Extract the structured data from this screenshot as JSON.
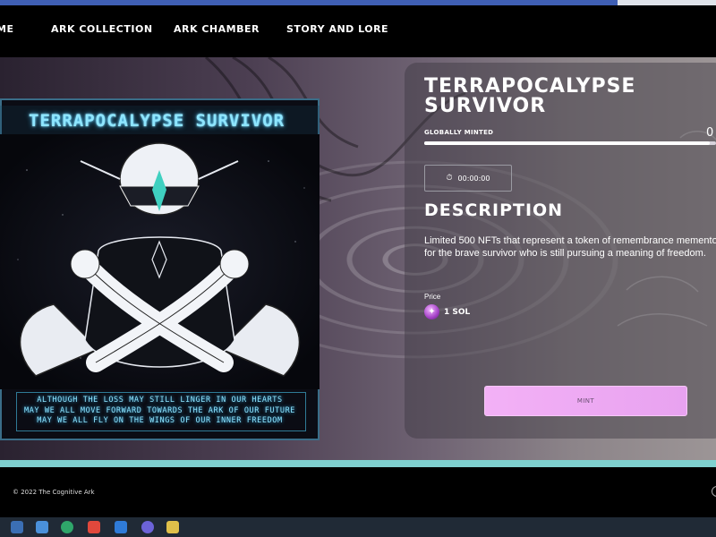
{
  "nav": {
    "items": [
      "ME",
      "ARK COLLECTION",
      "ARK CHAMBER",
      "STORY AND LORE"
    ]
  },
  "artwork": {
    "title": "TERRAPOCALYPSE SURVIVOR",
    "caption_lines": [
      "ALTHOUGH THE LOSS MAY STILL LINGER IN OUR HEARTS",
      "MAY WE ALL MOVE FORWARD TOWARDS THE ARK OF OUR FUTURE",
      "MAY WE ALL FLY ON THE WINGS OF OUR INNER FREEDOM"
    ]
  },
  "nft": {
    "title": "TERRAPOCALYPSE SURVIVOR",
    "minted_label": "GLOBALLY MINTED",
    "minted_count": "0",
    "minted_fraction": 0.98,
    "timer": "00:00:00",
    "description_heading": "DESCRIPTION",
    "description": "Limited 500 NFTs that represent a token of remembrance memento for the brave survivor who is still pursuing a meaning of freedom.",
    "price_label": "Price",
    "price_value": "1 SOL",
    "mint_label": "MINT"
  },
  "footer": {
    "copyright": "© 2022 The Cognitive Ark"
  },
  "colors": {
    "accent_cyan": "#8ee6ff",
    "mint_button": "#f3b1f6",
    "hero_line": "#7fd0cf"
  }
}
